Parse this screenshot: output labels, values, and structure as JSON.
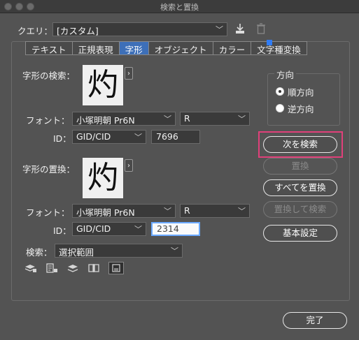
{
  "window": {
    "title": "検索と置換"
  },
  "query": {
    "label": "クエリ：",
    "value": "[カスタム]"
  },
  "tabs": [
    {
      "label": "テキスト",
      "active": false
    },
    {
      "label": "正規表現",
      "active": false
    },
    {
      "label": "字形",
      "active": true
    },
    {
      "label": "オブジェクト",
      "active": false
    },
    {
      "label": "カラー",
      "active": false
    },
    {
      "label": "文字種変換",
      "active": false
    }
  ],
  "find": {
    "label": "字形の検索：",
    "glyph": "灼",
    "font_label": "フォント：",
    "font": "小塚明朝 Pr6N",
    "style": "R",
    "id_label": "ID：",
    "id_type": "GID/CID",
    "id_value": "7696"
  },
  "replace": {
    "label": "字形の置換：",
    "glyph": "灼",
    "font_label": "フォント：",
    "font": "小塚明朝 Pr6N",
    "style": "R",
    "id_label": "ID：",
    "id_type": "GID/CID",
    "id_value": "2314"
  },
  "search": {
    "label": "検索：",
    "value": "選択範囲"
  },
  "direction": {
    "label": "方向",
    "forward": "順方向",
    "backward": "逆方向",
    "selected": "forward"
  },
  "buttons": {
    "find_next": "次を検索",
    "replace": "置換",
    "replace_all": "すべてを置換",
    "replace_find": "置換して検索",
    "basic_settings": "基本設定",
    "done": "完了"
  },
  "colors": {
    "background": "#535353",
    "highlight": "#e0407a",
    "active_tab": "#3d6fb8"
  }
}
